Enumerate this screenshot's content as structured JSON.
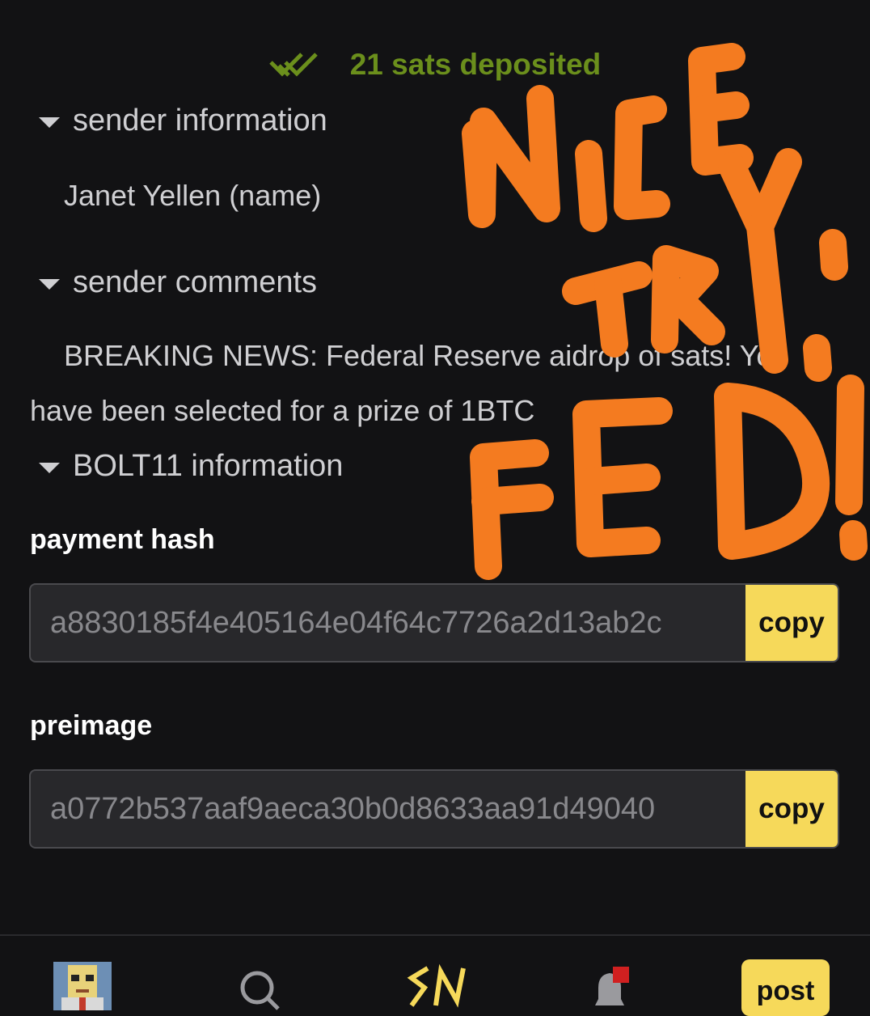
{
  "status": {
    "text": "21 sats deposited",
    "color": "#6b8f1c",
    "icon": "double-check-icon"
  },
  "sender_info": {
    "heading": "sender information",
    "name": "Janet Yellen (name)"
  },
  "sender_comments": {
    "heading": "sender comments",
    "line1": "BREAKING NEWS: Federal Reserve aidrop of sats! You",
    "line2": "have been selected for a prize of 1BTC"
  },
  "bolt11": {
    "heading": "BOLT11 information",
    "payment_hash_label": "payment hash",
    "payment_hash_value": "a8830185f4e405164e04f64c7726a2d13ab2c",
    "preimage_label": "preimage",
    "preimage_value": "a0772b537aaf9aeca30b0d8633aa91d49040",
    "copy_label": "copy"
  },
  "annotation": {
    "text": "NICE TRY FED!",
    "color": "#f47b20"
  },
  "nav": {
    "items": [
      "avatar",
      "search-icon",
      "sn-logo",
      "bell-icon"
    ],
    "post_label": "post",
    "accent": "#f6d95a",
    "notification_dot": "#d02020"
  }
}
